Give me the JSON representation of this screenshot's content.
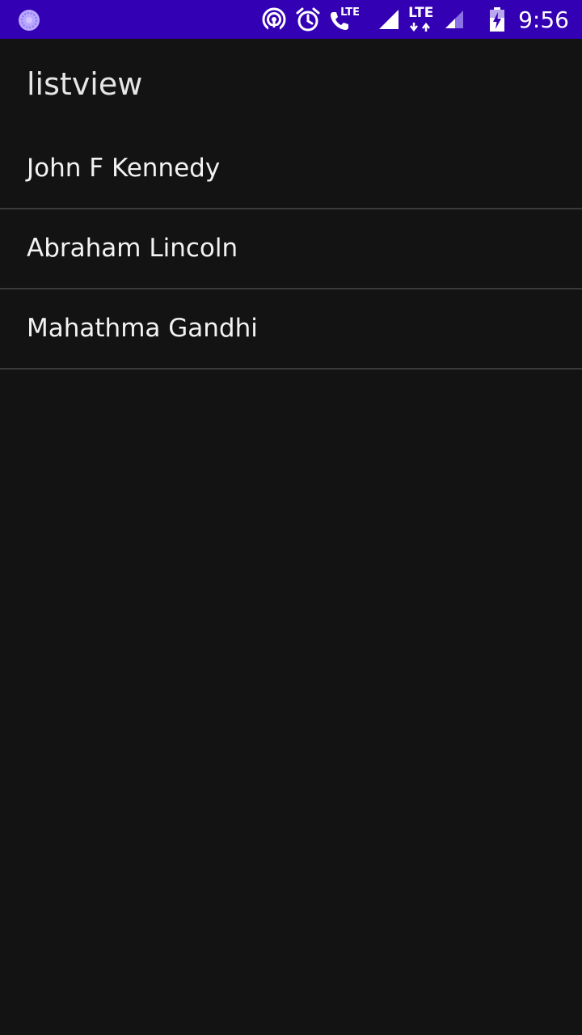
{
  "status_bar": {
    "background_color": "#3400b3",
    "left_icon": "app-notification-icon",
    "icons": [
      "hotspot-icon",
      "alarm-icon",
      "volte-call-icon",
      "signal-icon",
      "lte-data-icon",
      "signal-icon-2",
      "battery-charging-icon"
    ],
    "volte_label": "LTE",
    "data_label": "LTE",
    "time": "9:56"
  },
  "app_bar": {
    "title": "listview"
  },
  "list": {
    "items": [
      {
        "label": "John F Kennedy"
      },
      {
        "label": "Abraham Lincoln"
      },
      {
        "label": "Mahathma Gandhi"
      }
    ]
  }
}
